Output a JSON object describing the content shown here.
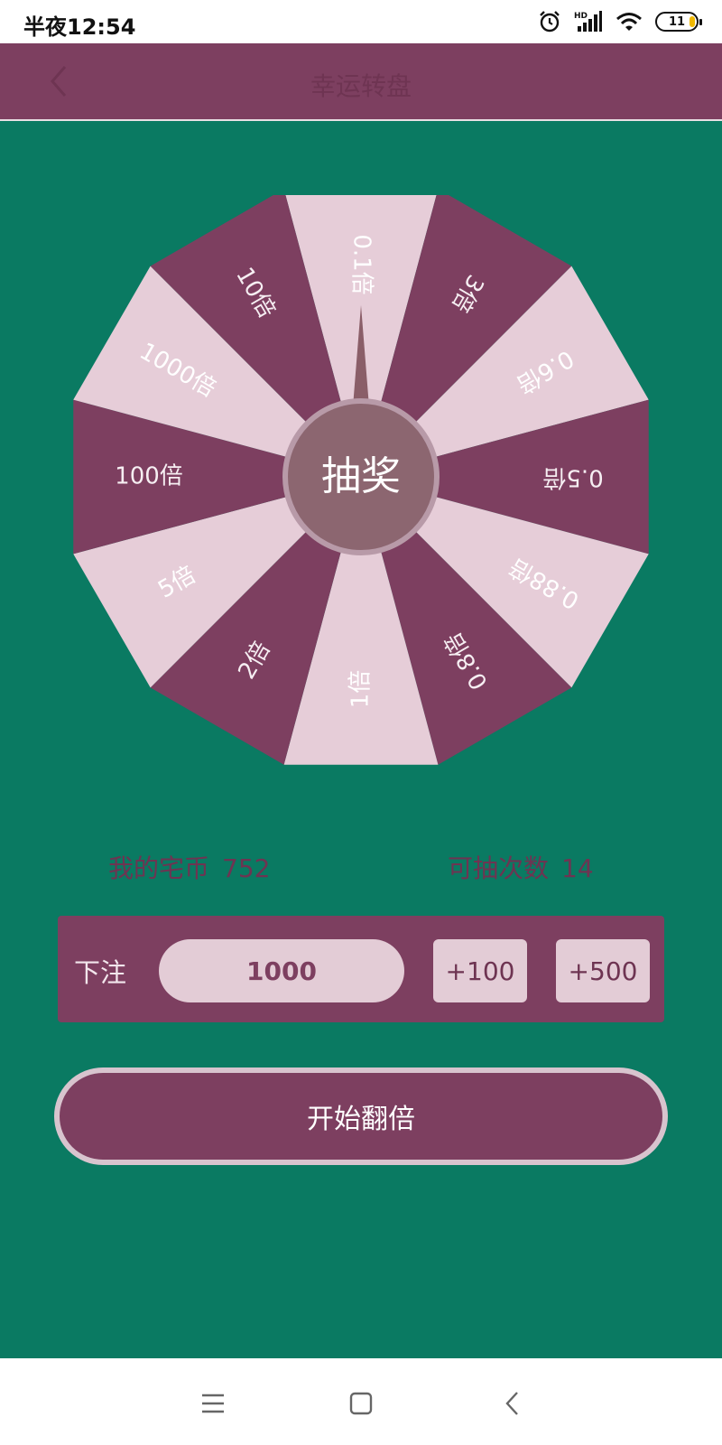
{
  "status": {
    "time": "半夜12:54",
    "battery": "11"
  },
  "appbar": {
    "title": "幸运转盘"
  },
  "wheel": {
    "center_label": "抽奖",
    "segments": [
      "0.1倍",
      "3倍",
      "0.6倍",
      "0.5倍",
      "0.88倍",
      "0.8倍",
      "1倍",
      "2倍",
      "5倍",
      "100倍",
      "1000倍",
      "10倍"
    ],
    "colors": {
      "dark": "#7d3f60",
      "light": "#e6cdd8",
      "hub": "#8c6670"
    }
  },
  "stats": {
    "coins_label": "我的宅币",
    "coins_value": "752",
    "draws_label": "可抽次数",
    "draws_value": "14"
  },
  "bet": {
    "label": "下注",
    "amount": "1000",
    "add_100": "+100",
    "add_500": "+500"
  },
  "start_button": "开始翻倍"
}
